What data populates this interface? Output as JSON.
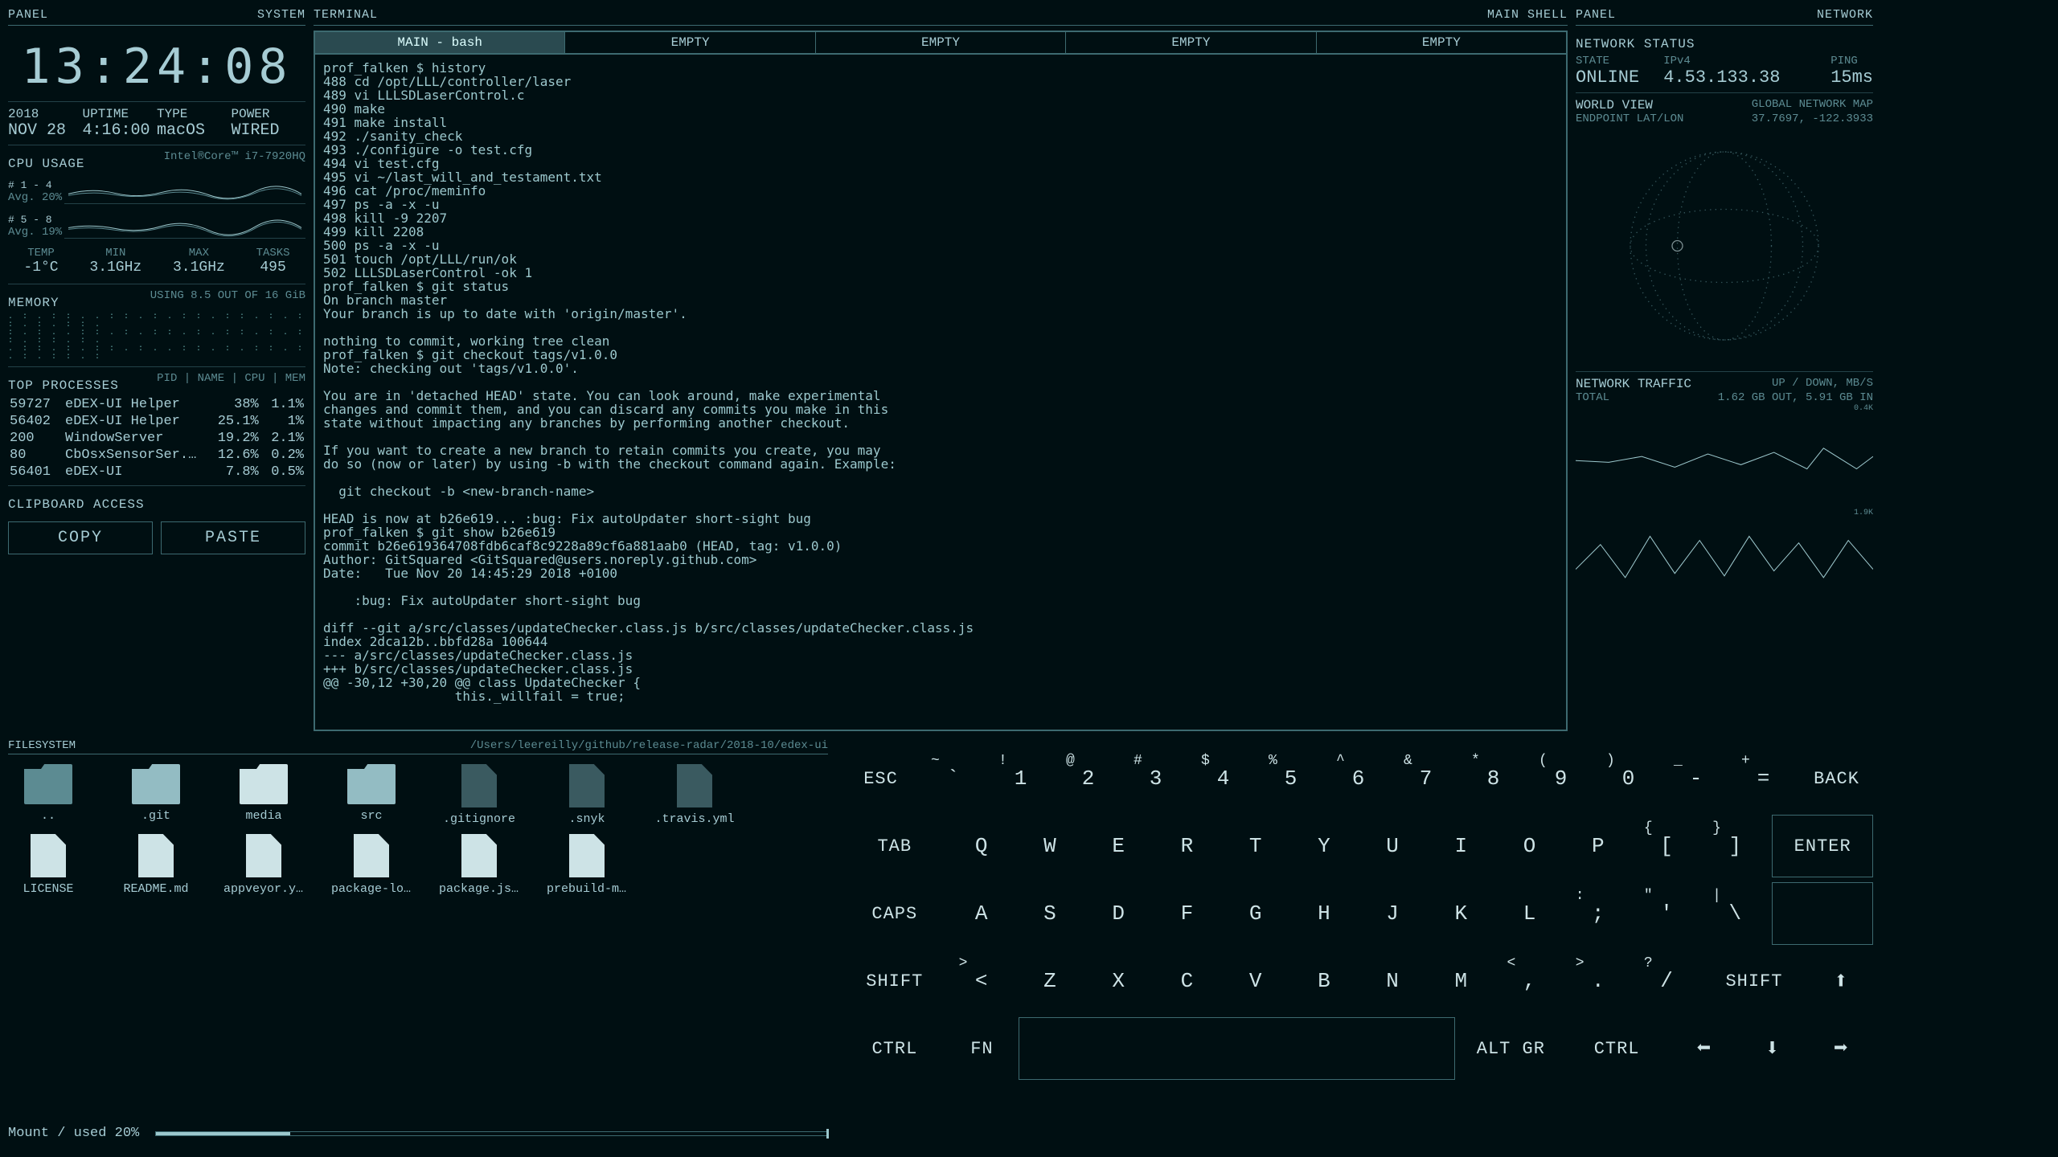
{
  "left": {
    "hdr_l": "PANEL",
    "hdr_r": "SYSTEM",
    "clock": "13:24:08",
    "date": {
      "lab": "2018",
      "val": "NOV 28"
    },
    "uptime": {
      "lab": "UPTIME",
      "val": "4:16:00"
    },
    "type": {
      "lab": "TYPE",
      "val": "macOS"
    },
    "power": {
      "lab": "POWER",
      "val": "WIRED"
    },
    "cpu_title": "CPU USAGE",
    "cpu_chip": "Intel®Core™ i7-7920HQ",
    "core1": {
      "lab": "# 1 - 4",
      "avg": "Avg. 20%"
    },
    "core2": {
      "lab": "# 5 - 8",
      "avg": "Avg. 19%"
    },
    "temp": {
      "lab": "TEMP",
      "val": "-1°C"
    },
    "min": {
      "lab": "MIN",
      "val": "3.1GHz"
    },
    "max": {
      "lab": "MAX",
      "val": "3.1GHz"
    },
    "tasks": {
      "lab": "TASKS",
      "val": "495"
    },
    "mem_title": "MEMORY",
    "mem_sub": "USING 8.5 OUT OF 16 GiB",
    "proc_title": "TOP PROCESSES",
    "proc_cols": [
      "PID",
      "NAME",
      "CPU",
      "MEM"
    ],
    "procs": [
      {
        "pid": "59727",
        "name": "eDEX-UI Helper",
        "cpu": "38%",
        "mem": "1.1%"
      },
      {
        "pid": "56402",
        "name": "eDEX-UI Helper",
        "cpu": "25.1%",
        "mem": "1%"
      },
      {
        "pid": "200",
        "name": "WindowServer",
        "cpu": "19.2%",
        "mem": "2.1%"
      },
      {
        "pid": "80",
        "name": "CbOsxSensorSer...",
        "cpu": "12.6%",
        "mem": "0.2%"
      },
      {
        "pid": "56401",
        "name": "eDEX-UI",
        "cpu": "7.8%",
        "mem": "0.5%"
      }
    ],
    "clip_title": "CLIPBOARD ACCESS",
    "copy": "COPY",
    "paste": "PASTE"
  },
  "center": {
    "hdr_l": "TERMINAL",
    "hdr_r": "MAIN SHELL",
    "tabs": [
      "MAIN - bash",
      "EMPTY",
      "EMPTY",
      "EMPTY",
      "EMPTY"
    ],
    "lines": [
      "prof_falken $ history",
      "488 cd /opt/LLL/controller/laser",
      "489 vi LLLSDLaserControl.c",
      "490 make",
      "491 make install",
      "492 ./sanity_check",
      "493 ./configure -o test.cfg",
      "494 vi test.cfg",
      "495 vi ~/last_will_and_testament.txt",
      "496 cat /proc/meminfo",
      "497 ps -a -x -u",
      "498 kill -9 2207",
      "499 kill 2208",
      "500 ps -a -x -u",
      "501 touch /opt/LLL/run/ok",
      "502 LLLSDLaserControl -ok 1",
      "prof_falken $ git status",
      "On branch master",
      "Your branch is up to date with 'origin/master'.",
      "",
      "nothing to commit, working tree clean",
      "prof_falken $ git checkout tags/v1.0.0",
      "Note: checking out 'tags/v1.0.0'.",
      "",
      "You are in 'detached HEAD' state. You can look around, make experimental",
      "changes and commit them, and you can discard any commits you make in this",
      "state without impacting any branches by performing another checkout.",
      "",
      "If you want to create a new branch to retain commits you create, you may",
      "do so (now or later) by using -b with the checkout command again. Example:",
      "",
      "  git checkout -b <new-branch-name>",
      "",
      "HEAD is now at b26e619... :bug: Fix autoUpdater short-sight bug",
      "prof_falken $ git show b26e619",
      "commit b26e619364708fdb6caf8c9228a89cf6a881aab0 (HEAD, tag: v1.0.0)",
      "Author: GitSquared <GitSquared@users.noreply.github.com>",
      "Date:   Tue Nov 20 14:45:29 2018 +0100",
      "",
      "    :bug: Fix autoUpdater short-sight bug",
      "",
      "diff --git a/src/classes/updateChecker.class.js b/src/classes/updateChecker.class.js",
      "index 2dca12b..bbfd28a 100644",
      "--- a/src/classes/updateChecker.class.js",
      "+++ b/src/classes/updateChecker.class.js",
      "@@ -30,12 +30,20 @@ class UpdateChecker {",
      "                 this._willfail = true;"
    ]
  },
  "right": {
    "hdr_l": "PANEL",
    "hdr_r": "NETWORK",
    "status_title": "NETWORK STATUS",
    "state": {
      "lab": "STATE",
      "val": "ONLINE"
    },
    "ipv4": {
      "lab": "IPv4",
      "val": "4.53.133.38"
    },
    "ping": {
      "lab": "PING",
      "val": "15ms"
    },
    "world_l": "WORLD VIEW",
    "world_r": "GLOBAL NETWORK MAP",
    "endpoint_l": "ENDPOINT LAT/LON",
    "endpoint_r": "37.7697, -122.3933",
    "traffic_title": "NETWORK TRAFFIC",
    "traffic_sub": "UP / DOWN, MB/S",
    "total_l": "TOTAL",
    "total_r": "1.62 GB OUT, 5.91 GB IN"
  },
  "fs": {
    "hdr_l": "FILESYSTEM",
    "path": "/Users/leereilly/github/release-radar/2018-10/edex-ui",
    "files": [
      {
        "name": "..",
        "type": "folder-shadow"
      },
      {
        "name": ".git",
        "type": "folder"
      },
      {
        "name": "media",
        "type": "folder-light"
      },
      {
        "name": "src",
        "type": "folder"
      },
      {
        "name": ".gitignore",
        "type": "file-dark"
      },
      {
        "name": ".snyk",
        "type": "file-dark"
      },
      {
        "name": ".travis.yml",
        "type": "file-dark"
      },
      {
        "name": "LICENSE",
        "type": "file"
      },
      {
        "name": "README.md",
        "type": "file"
      },
      {
        "name": "appveyor.yml",
        "type": "file"
      },
      {
        "name": "package-lock...",
        "type": "file"
      },
      {
        "name": "package.json",
        "type": "file"
      },
      {
        "name": "prebuild-mini...",
        "type": "file"
      }
    ],
    "mount": "Mount / used 20%"
  },
  "kb": {
    "row1": [
      [
        "~",
        "`"
      ],
      [
        "!",
        "1"
      ],
      [
        "@",
        "2"
      ],
      [
        "#",
        "3"
      ],
      [
        "$",
        "4"
      ],
      [
        "%",
        "5"
      ],
      [
        "^",
        "6"
      ],
      [
        "&",
        "7"
      ],
      [
        "*",
        "8"
      ],
      [
        "(",
        "9"
      ],
      [
        ")",
        "0"
      ],
      [
        "_",
        "-"
      ],
      [
        "+",
        "="
      ]
    ],
    "row1_esc": "ESC",
    "row1_back": "BACK",
    "row2": [
      "Q",
      "W",
      "E",
      "R",
      "T",
      "Y",
      "U",
      "I",
      "O",
      "P"
    ],
    "row2_tab": "TAB",
    "row2_br": [
      [
        "{",
        "["
      ],
      [
        "}",
        "]"
      ]
    ],
    "row2_enter": "ENTER",
    "row3": [
      "A",
      "S",
      "D",
      "F",
      "G",
      "H",
      "J",
      "K",
      "L"
    ],
    "row3_caps": "CAPS",
    "row3_punc": [
      [
        ":",
        ";"
      ],
      [
        "\"",
        "'"
      ],
      [
        "|",
        "\\"
      ]
    ],
    "row4": [
      "Z",
      "X",
      "C",
      "V",
      "B",
      "N",
      "M"
    ],
    "row4_shift": "SHIFT",
    "row4_punc": [
      [
        "<",
        ","
      ],
      [
        ">",
        "."
      ],
      [
        "?",
        "/"
      ]
    ],
    "row5": {
      "ctrl": "CTRL",
      "fn": "FN",
      "altgr": "ALT GR"
    }
  }
}
